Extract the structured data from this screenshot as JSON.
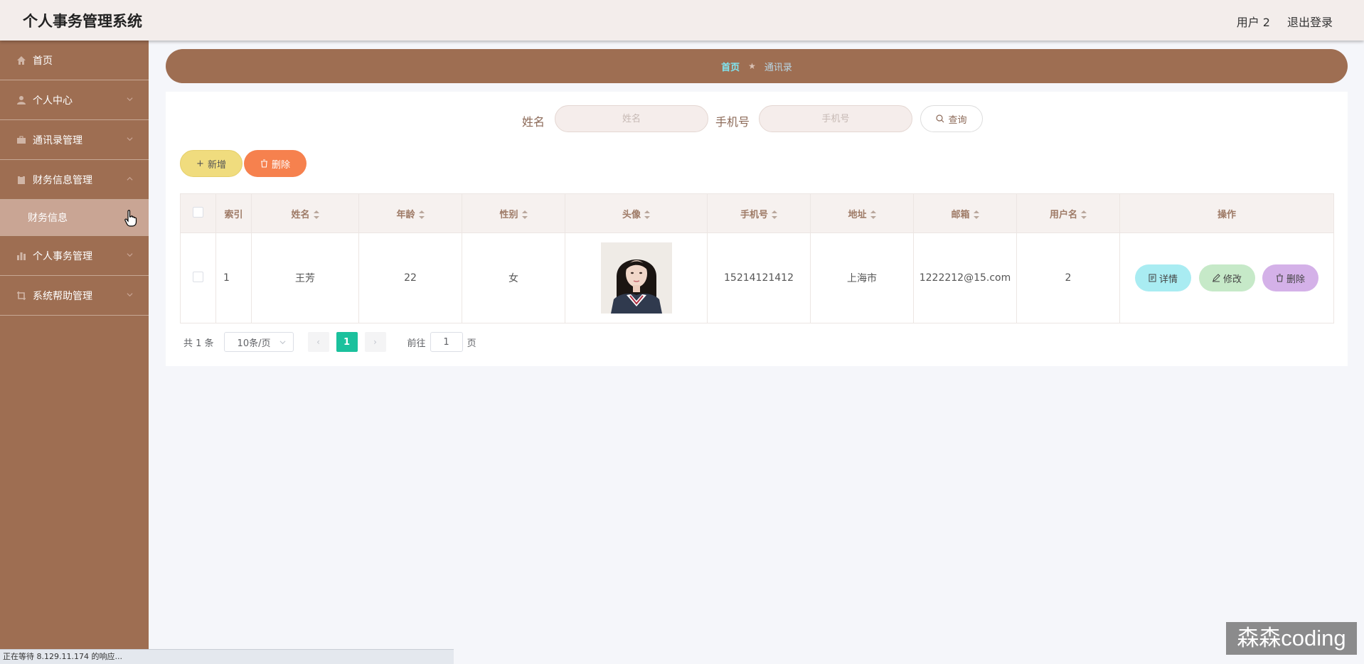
{
  "header": {
    "app_title": "个人事务管理系统",
    "user_label": "用户 2",
    "logout_label": "退出登录"
  },
  "sidebar": {
    "items": [
      {
        "label": "首页",
        "icon": "home-icon"
      },
      {
        "label": "个人中心",
        "icon": "user-icon"
      },
      {
        "label": "通讯录管理",
        "icon": "briefcase-icon"
      },
      {
        "label": "财务信息管理",
        "icon": "clipboard-icon",
        "expanded": true
      },
      {
        "label": "个人事务管理",
        "icon": "chart-icon"
      },
      {
        "label": "系统帮助管理",
        "icon": "crop-icon"
      }
    ],
    "submenu": {
      "label": "财务信息"
    }
  },
  "breadcrumb": {
    "home": "首页",
    "current": "通讯录"
  },
  "search": {
    "name_label": "姓名",
    "name_placeholder": "姓名",
    "phone_label": "手机号",
    "phone_placeholder": "手机号",
    "query_label": "查询"
  },
  "toolbar": {
    "add_label": "新增",
    "delete_label": "删除"
  },
  "table": {
    "columns": [
      "索引",
      "姓名",
      "年龄",
      "性别",
      "头像",
      "手机号",
      "地址",
      "邮箱",
      "用户名",
      "操作"
    ],
    "rows": [
      {
        "index": "1",
        "name": "王芳",
        "age": "22",
        "gender": "女",
        "phone": "15214121412",
        "address": "上海市",
        "email": "1222212@15.com",
        "username": "2"
      }
    ],
    "actions": {
      "detail": "详情",
      "edit": "修改",
      "delete": "删除"
    }
  },
  "pagination": {
    "total_text": "共 1 条",
    "page_size": "10条/页",
    "current_page": "1",
    "goto_prefix": "前往",
    "goto_value": "1",
    "goto_suffix": "页"
  },
  "statusbar": {
    "text": "正在等待 8.129.11.174 的响应..."
  },
  "watermark": {
    "text": "森森coding"
  },
  "colors": {
    "sidebar": "#9e6e52",
    "accent_green": "#1bc19d",
    "add_button": "#f0dc7e",
    "delete_button": "#f6814e"
  }
}
